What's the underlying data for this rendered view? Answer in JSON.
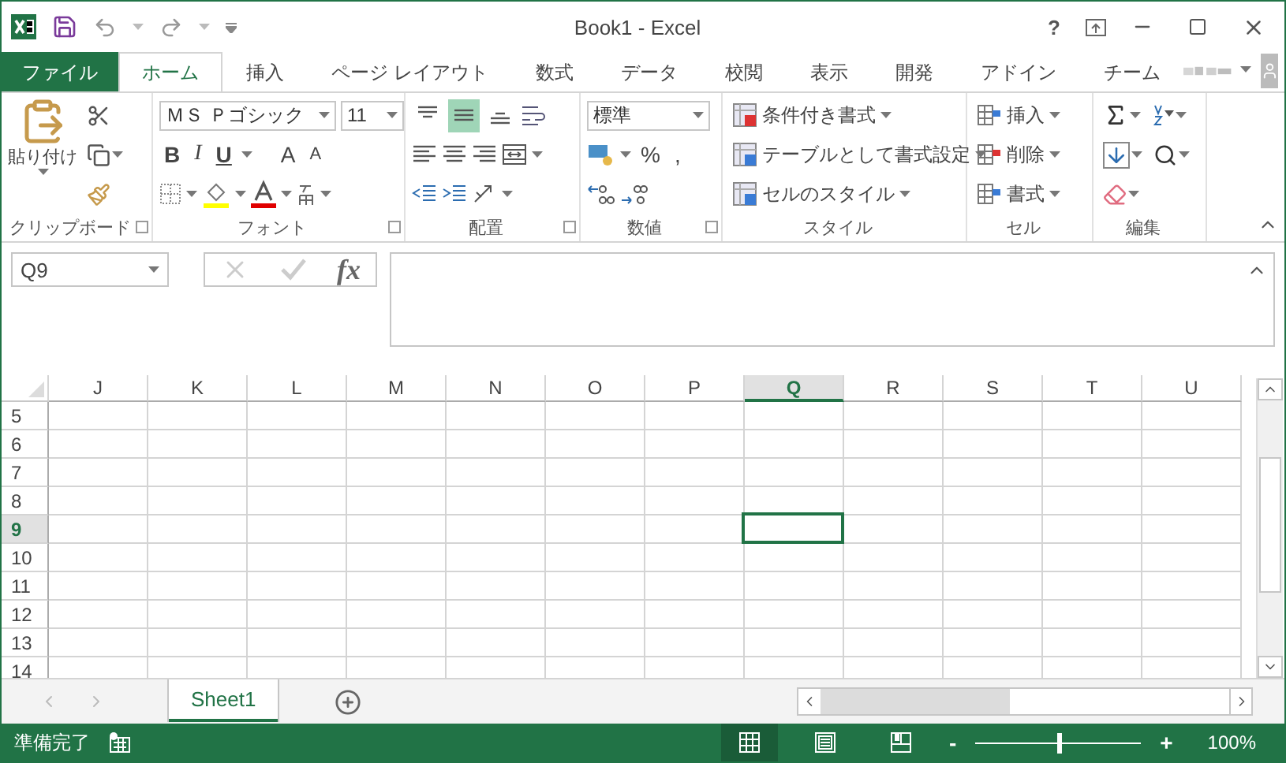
{
  "window": {
    "title": "Book1 - Excel",
    "help": "?"
  },
  "tabs": [
    {
      "label": "ファイル",
      "kind": "file",
      "selected": false
    },
    {
      "label": "ホーム",
      "kind": "tab",
      "selected": true
    },
    {
      "label": "挿入",
      "kind": "tab",
      "selected": false
    },
    {
      "label": "ページ レイアウト",
      "kind": "tab",
      "selected": false
    },
    {
      "label": "数式",
      "kind": "tab",
      "selected": false
    },
    {
      "label": "データ",
      "kind": "tab",
      "selected": false
    },
    {
      "label": "校閲",
      "kind": "tab",
      "selected": false
    },
    {
      "label": "表示",
      "kind": "tab",
      "selected": false
    },
    {
      "label": "開発",
      "kind": "tab",
      "selected": false
    },
    {
      "label": "アドイン",
      "kind": "tab",
      "selected": false
    },
    {
      "label": "チーム",
      "kind": "tab",
      "selected": false
    }
  ],
  "ribbon": {
    "clipboard": {
      "label": "クリップボード",
      "paste": "貼り付け"
    },
    "font": {
      "label": "フォント",
      "name": "ＭＳ Ｐゴシック",
      "size": "11",
      "bold": "B",
      "italic": "I",
      "underline": "U",
      "grow": "A",
      "shrink": "A"
    },
    "alignment": {
      "label": "配置",
      "vertical": [
        {
          "kind": "top",
          "selected": false
        },
        {
          "kind": "middle",
          "selected": true
        },
        {
          "kind": "bottom",
          "selected": false
        }
      ]
    },
    "number": {
      "label": "数値",
      "format": "標準",
      "percent": "%",
      "comma": ","
    },
    "styles": {
      "label": "スタイル",
      "buttons": [
        "条件付き書式",
        "テーブルとして書式設定",
        "セルのスタイル"
      ]
    },
    "cells": {
      "label": "セル",
      "buttons": [
        "挿入",
        "削除",
        "書式"
      ]
    },
    "editing": {
      "label": "編集"
    }
  },
  "formula_bar": {
    "name_box": "Q9",
    "function": "fx"
  },
  "sheet": {
    "columns": [
      {
        "label": "J",
        "selected": false
      },
      {
        "label": "K",
        "selected": false
      },
      {
        "label": "L",
        "selected": false
      },
      {
        "label": "M",
        "selected": false
      },
      {
        "label": "N",
        "selected": false
      },
      {
        "label": "O",
        "selected": false
      },
      {
        "label": "P",
        "selected": false
      },
      {
        "label": "Q",
        "selected": true
      },
      {
        "label": "R",
        "selected": false
      },
      {
        "label": "S",
        "selected": false
      },
      {
        "label": "T",
        "selected": false
      },
      {
        "label": "U",
        "selected": false
      }
    ],
    "rows": [
      {
        "label": "5",
        "selected": false
      },
      {
        "label": "6",
        "selected": false
      },
      {
        "label": "7",
        "selected": false
      },
      {
        "label": "8",
        "selected": false
      },
      {
        "label": "9",
        "selected": true
      },
      {
        "label": "10",
        "selected": false
      },
      {
        "label": "11",
        "selected": false
      },
      {
        "label": "12",
        "selected": false
      },
      {
        "label": "13",
        "selected": false
      },
      {
        "label": "14",
        "selected": false
      }
    ]
  },
  "sheet_tabs": [
    {
      "label": "Sheet1",
      "selected": true
    }
  ],
  "status_bar": {
    "text": "準備完了",
    "views": [
      {
        "kind": "normal",
        "selected": true
      },
      {
        "kind": "page_layout",
        "selected": false
      },
      {
        "kind": "page_break",
        "selected": false
      }
    ],
    "zoom": {
      "minus": "-",
      "plus": "+",
      "level": 0.5,
      "reading": "100%"
    }
  }
}
